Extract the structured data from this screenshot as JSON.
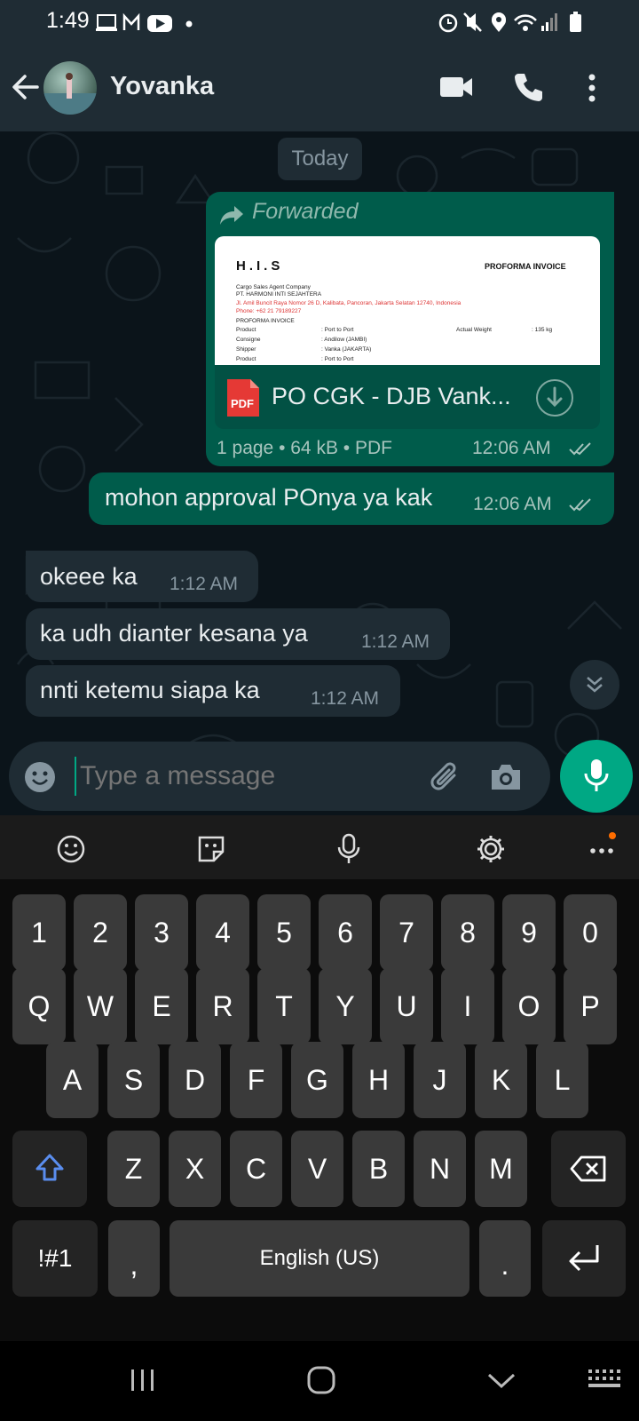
{
  "status_bar": {
    "time": "1:49"
  },
  "header": {
    "contact_name": "Yovanka"
  },
  "chat": {
    "date_label": "Today",
    "forwarded_message": {
      "forwarded_label": "Forwarded",
      "preview": {
        "logo": "H.I.S",
        "doc_title": "PROFORMA INVOICE",
        "line1": "Cargo Sales Agent Company",
        "line2": "PT. HARMONI INTI SEJAHTERA",
        "line3": "Jl. Amil Buncit Raya Nomor 26 D, Kalibata, Pancoran, Jakarta Selatan 12740, Indonesia",
        "line4": "Phone: +62 21 79189227",
        "line5": "PROFORMA INVOICE",
        "rows": [
          {
            "label": "Product",
            "value": ": Port to Port",
            "label2": "Actual Weight",
            "value2": ": 135 kg"
          },
          {
            "label": "Consigne",
            "value": ": Andilow (JAMBI)",
            "label2": "",
            "value2": ""
          },
          {
            "label": "Shipper",
            "value": ": Vanka (JAKARTA)",
            "label2": "",
            "value2": ""
          },
          {
            "label": "Product",
            "value": ": Port to Port",
            "label2": "",
            "value2": ""
          }
        ]
      },
      "file_icon_label": "PDF",
      "file_name": "PO CGK - DJB Vank...",
      "file_meta": "1 page • 64 kB • PDF",
      "time": "12:06 AM"
    },
    "messages": [
      {
        "direction": "out",
        "text": "mohon approval POnya ya kak",
        "time": "12:06 AM"
      },
      {
        "direction": "in",
        "text": "okeee ka",
        "time": "1:12 AM"
      },
      {
        "direction": "in",
        "text": "ka udh dianter kesana ya",
        "time": "1:12 AM"
      },
      {
        "direction": "in",
        "text": "nnti ketemu siapa ka",
        "time": "1:12 AM"
      }
    ]
  },
  "input": {
    "placeholder": "Type a message"
  },
  "keyboard": {
    "row_numbers": [
      "1",
      "2",
      "3",
      "4",
      "5",
      "6",
      "7",
      "8",
      "9",
      "0"
    ],
    "row_q": [
      "Q",
      "W",
      "E",
      "R",
      "T",
      "Y",
      "U",
      "I",
      "O",
      "P"
    ],
    "row_a": [
      "A",
      "S",
      "D",
      "F",
      "G",
      "H",
      "J",
      "K",
      "L"
    ],
    "row_z": [
      "Z",
      "X",
      "C",
      "V",
      "B",
      "N",
      "M"
    ],
    "symbols_key": "!#1",
    "comma_key": ",",
    "space_key": "English (US)",
    "period_key": "."
  },
  "colors": {
    "accent": "#00a884",
    "outgoing_bubble": "#005c4b",
    "incoming_bubble": "#1f2c34",
    "header": "#1f2c34",
    "pdf_red": "#e53935"
  },
  "icons": [
    "back-arrow-icon",
    "video-call-icon",
    "phone-icon",
    "more-vert-icon",
    "forward-icon",
    "pdf-icon",
    "download-icon",
    "double-check-icon",
    "scroll-down-icon",
    "emoji-icon",
    "attach-icon",
    "camera-icon",
    "mic-icon",
    "sticker-icon",
    "settings-icon",
    "shift-icon",
    "backspace-icon",
    "enter-icon"
  ]
}
